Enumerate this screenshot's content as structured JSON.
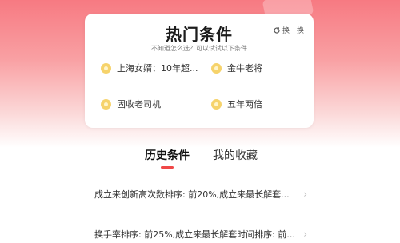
{
  "hot": {
    "title": "热门条件",
    "refresh_label": "换一换",
    "subtitle": "不知道怎么选？可以试试以下条件",
    "items": [
      {
        "label": "上海女婿：10年超...",
        "icon": "coin-icon"
      },
      {
        "label": "金牛老将",
        "icon": "coin-icon"
      },
      {
        "label": "固收老司机",
        "icon": "coin-icon"
      },
      {
        "label": "五年两倍",
        "icon": "coin-icon"
      }
    ]
  },
  "tabs": {
    "history": "历史条件",
    "favorites": "我的收藏"
  },
  "history_list": [
    {
      "text": "成立来创新高次数排序: 前20%,成立来最长解套..."
    },
    {
      "text": "换手率排序: 前25%,成立来最长解套时间排序: 前..."
    }
  ],
  "colors": {
    "accent": "#f04848",
    "header_gradient_top": "#f77a82",
    "icon": "#f6d36b"
  }
}
